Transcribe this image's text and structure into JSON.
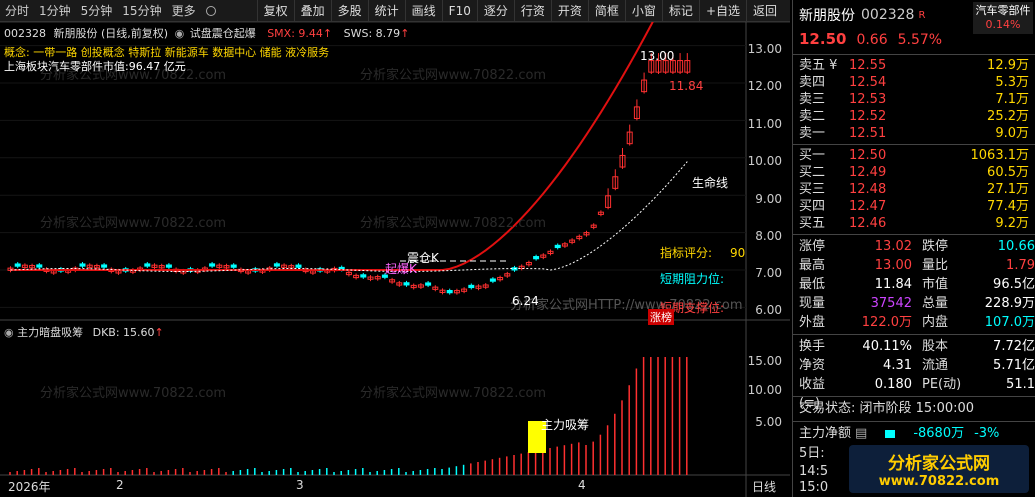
{
  "toolbar": {
    "periods": [
      "分时",
      "1分钟",
      "5分钟",
      "15分钟",
      "更多"
    ],
    "buttons": [
      "复权",
      "叠加",
      "多股",
      "统计",
      "画线",
      "F10",
      "逐分",
      "行资",
      "开资",
      "简框",
      "小窗",
      "标记",
      "+自选",
      "返回"
    ]
  },
  "chart": {
    "title_code": "002328",
    "title_name": "新朋股份",
    "title_mode": "(日线,前复权)",
    "formula": "试盘震仓起爆",
    "smx": "SMX: 9.44",
    "sws": "SWS: 8.79",
    "concepts": "概念: 一带一路 创投概念 特斯拉 新能源车 数据中心 储能 液冷服务",
    "region": "上海板块汽车零部件市值:96.47 亿元",
    "ann_high": "13.00",
    "ann_11": "11.84",
    "ann_life": "生命线",
    "ann_score_label": "指标评分:",
    "ann_score_val": "90",
    "ann_resist": "短期阻力位:",
    "ann_support": "短期支撑位:",
    "ann_shake": "震仓K",
    "ann_start": "起爆K",
    "ann_low": "6.24",
    "ann_limit": "涨",
    "ann_bang": "榜",
    "wm_url": "分析家公式网www.70822.com",
    "wm_http": "分析家公式网HTTP://www.70822.com",
    "price_ticks": [
      "13.00",
      "12.00",
      "11.00",
      "10.00",
      "9.00",
      "8.00",
      "7.00",
      "6.00"
    ],
    "sub_title": "主力暗盘吸筹",
    "sub_dkb": "DKB: 15.60",
    "sub_ticks": [
      "15.00",
      "10.00",
      "5.00"
    ],
    "sub_ann": "主力吸筹",
    "x_labels": [
      "2026年",
      "2",
      "3",
      "4",
      "日线"
    ]
  },
  "panel": {
    "name": "新朋股份",
    "code": "002328",
    "r_mark": "R",
    "sector": "汽车零部件",
    "sector_pct": "0.14%",
    "price": "12.50",
    "change": "0.66",
    "pct": "5.57%",
    "asks": [
      {
        "label": "卖五 ¥",
        "price": "12.55",
        "vol": "12.9万"
      },
      {
        "label": "卖四",
        "price": "12.54",
        "vol": "5.3万"
      },
      {
        "label": "卖三",
        "price": "12.53",
        "vol": "7.1万"
      },
      {
        "label": "卖二",
        "price": "12.52",
        "vol": "25.2万"
      },
      {
        "label": "卖一",
        "price": "12.51",
        "vol": "9.0万"
      }
    ],
    "bids": [
      {
        "label": "买一",
        "price": "12.50",
        "vol": "1063.1万"
      },
      {
        "label": "买二",
        "price": "12.49",
        "vol": "60.5万"
      },
      {
        "label": "买三",
        "price": "12.48",
        "vol": "27.1万"
      },
      {
        "label": "买四",
        "price": "12.47",
        "vol": "77.4万"
      },
      {
        "label": "买五",
        "price": "12.46",
        "vol": "9.2万"
      }
    ],
    "stats1": [
      {
        "k": "涨停",
        "v": "13.02",
        "vc": "red",
        "k2": "跌停",
        "v2": "10.66",
        "v2c": "green"
      },
      {
        "k": "最高",
        "v": "13.00",
        "vc": "red",
        "k2": "量比",
        "v2": "1.79",
        "v2c": "red"
      },
      {
        "k": "最低",
        "v": "11.84",
        "vc": "white",
        "k2": "市值",
        "v2": "96.5亿",
        "v2c": "white"
      },
      {
        "k": "现量",
        "v": "37542",
        "vc": "purple",
        "k2": "总量",
        "v2": "228.9万",
        "v2c": "white"
      },
      {
        "k": "外盘",
        "v": "122.0万",
        "vc": "red",
        "k2": "内盘",
        "v2": "107.0万",
        "v2c": "green"
      }
    ],
    "stats2": [
      {
        "k": "换手",
        "v": "40.11%",
        "vc": "white",
        "k2": "股本",
        "v2": "7.72亿",
        "v2c": "white"
      },
      {
        "k": "净资",
        "v": "4.31",
        "vc": "white",
        "k2": "流通",
        "v2": "5.71亿",
        "v2c": "white"
      },
      {
        "k": "收益(≡)",
        "v": "0.180",
        "vc": "white",
        "k2": "PE(动)",
        "v2": "51.1",
        "v2c": "white"
      }
    ],
    "trade_state": "交易状态: 闭市阶段 15:00:00",
    "flow_label": "主力净额",
    "flow_val": "-8680万",
    "flow_pct": "-3%",
    "day5": "5日:",
    "time_frag": "14:5",
    "time_frag2": "15:0",
    "logo1": "分析家公式网",
    "logo2": "www.70822.com"
  },
  "colors": {
    "up": "#ff3030",
    "down": "#00ffff",
    "accent": "#ffd700",
    "purple": "#cc44ff"
  }
}
